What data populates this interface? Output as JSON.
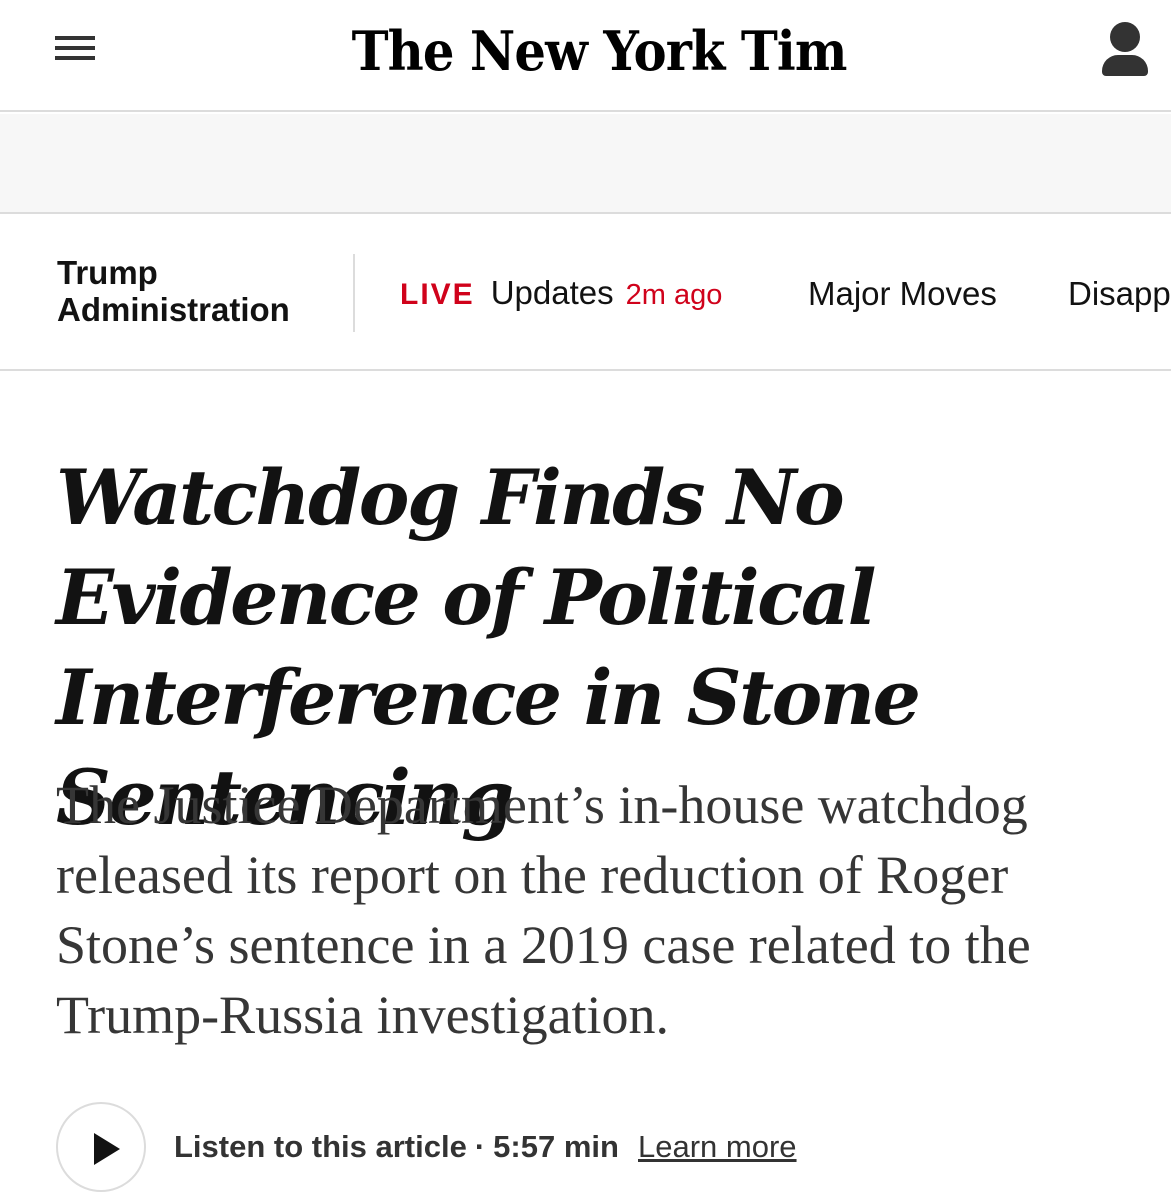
{
  "masthead": {
    "logo_text": "The New York Times",
    "menu_icon": "hamburger-menu-icon",
    "account_icon": "user-account-icon"
  },
  "ad_band": {},
  "section_nav": {
    "section_title": "Trump Administration",
    "live": {
      "tag": "LIVE",
      "label": "Updates",
      "time": "2m ago"
    },
    "links": [
      "Major Moves",
      "Disapp"
    ]
  },
  "article": {
    "headline": "Watchdog Finds No Evidence of Political Interference in Stone Sentencing",
    "summary": "The Justice Department’s in-house watchdog released its report on the reduction of Roger Stone’s sentence in a 2019 case related to the Trump-Russia investigation.",
    "audio": {
      "play_icon": "play-icon",
      "label": "Listen to this article",
      "separator": "·",
      "duration": "5:57 min",
      "learn_more": "Learn more"
    }
  },
  "colors": {
    "accent_live": "#d0021b",
    "text_primary": "#121212",
    "text_summary": "#363636",
    "divider": "#dcdcdc",
    "ad_background": "#f7f7f7"
  }
}
